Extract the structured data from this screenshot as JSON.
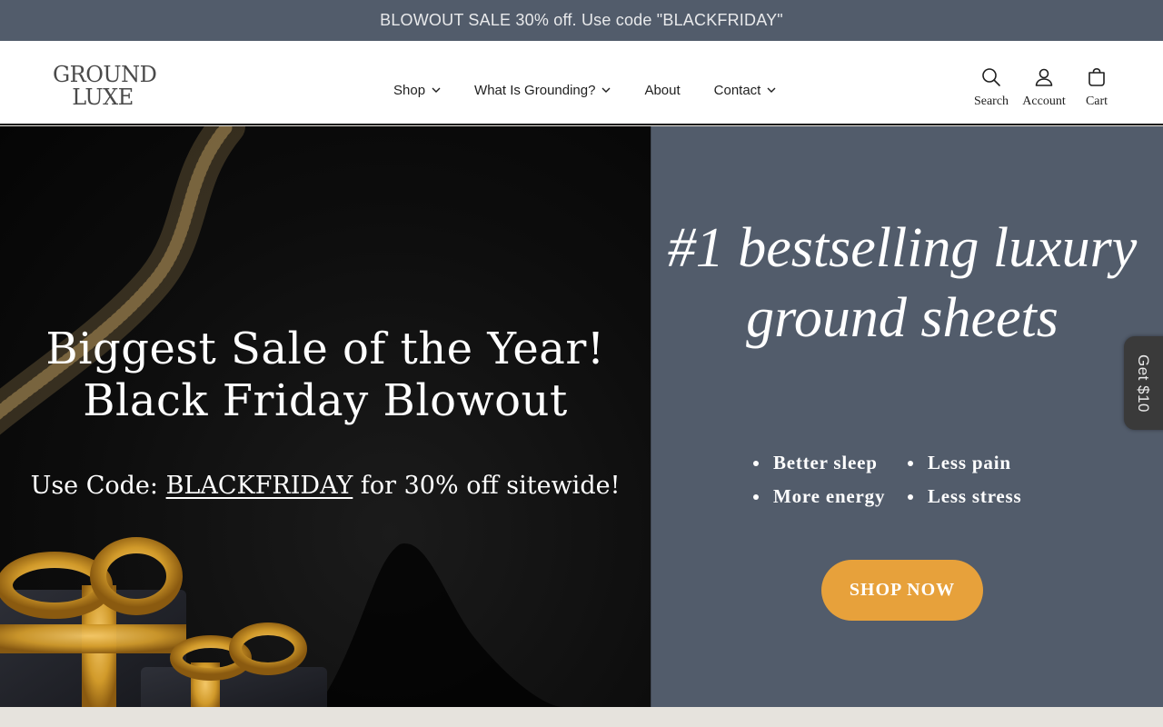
{
  "announcement": {
    "text": "BLOWOUT SALE 30% off. Use code \"BLACKFRIDAY\""
  },
  "header": {
    "logo": {
      "line1": "GROUND",
      "line2": "LUXE"
    },
    "nav": [
      {
        "label": "Shop",
        "dropdown": true
      },
      {
        "label": "What Is Grounding?",
        "dropdown": true
      },
      {
        "label": "About",
        "dropdown": false
      },
      {
        "label": "Contact",
        "dropdown": true
      }
    ],
    "icons": {
      "search": {
        "label": "Search",
        "icon": "search-icon"
      },
      "account": {
        "label": "Account",
        "icon": "user-icon"
      },
      "cart": {
        "label": "Cart",
        "icon": "bag-icon"
      }
    }
  },
  "hero": {
    "left": {
      "title_line1": "Biggest Sale of the Year!",
      "title_line2": "Black Friday Blowout",
      "code_prefix": "Use Code: ",
      "code": "BLACKFRIDAY",
      "code_suffix": " for 30% off sitewide!"
    },
    "right": {
      "tagline": "#1 bestselling luxury ground sheets",
      "benefits": [
        "Better sleep",
        "Less pain",
        "More energy",
        "Less stress"
      ],
      "cta": "SHOP NOW"
    }
  },
  "side_tab": {
    "label": "Get $10"
  },
  "colors": {
    "announcement_bg": "#525c6b",
    "hero_right_bg": "#525c6b",
    "cta_bg": "#e7a13b",
    "side_tab_bg": "#3a3a3a"
  }
}
